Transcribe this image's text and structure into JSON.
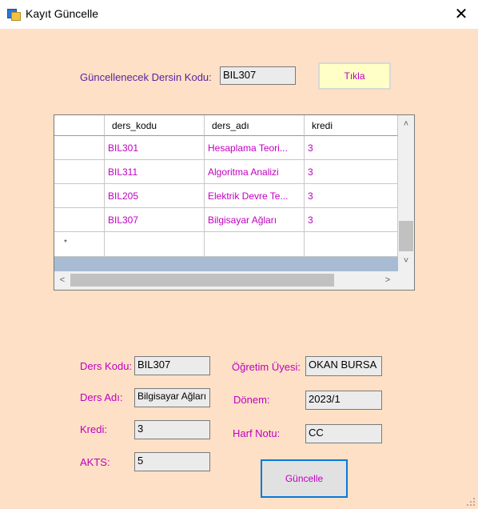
{
  "window": {
    "title": "Kayıt Güncelle",
    "close_glyph": "✕"
  },
  "lookup": {
    "label": "Güncellenecek Dersin Kodu:",
    "value": "BIL307",
    "button_label": "Tıkla"
  },
  "grid": {
    "columns": [
      "ders_kodu",
      "ders_adı",
      "kredi"
    ],
    "rows": [
      [
        "BIL301",
        "Hesaplama Teori...",
        "3"
      ],
      [
        "BIL311",
        "Algoritma Analizi",
        "3"
      ],
      [
        "BIL205",
        "Elektrik Devre Te...",
        "3"
      ],
      [
        "BIL307",
        "Bilgisayar Ağları",
        "3"
      ]
    ],
    "new_row_marker": "*",
    "scroll_up": "˄",
    "scroll_down": "˅",
    "scroll_left": "<",
    "scroll_right": ">"
  },
  "form": {
    "ders_kodu": {
      "label": "Ders Kodu:",
      "value": "BIL307"
    },
    "ders_adi": {
      "label": "Ders Adı:",
      "value": "Bilgisayar Ağları"
    },
    "kredi": {
      "label": "Kredi:",
      "value": "3"
    },
    "akts": {
      "label": "AKTS:",
      "value": "5"
    },
    "ogretim_uyesi": {
      "label": "Öğretim Üyesi:",
      "value": "OKAN BURSA"
    },
    "donem": {
      "label": "Dönem:",
      "value": "2023/1"
    },
    "harf_notu": {
      "label": "Harf Notu:",
      "value": "CC"
    },
    "update_button": "Güncelle"
  },
  "colors": {
    "background": "#fde0c5",
    "accent": "#c000c0",
    "label": "#5b1fa0",
    "focus_border": "#0a78d7"
  },
  "icons": {
    "app": "form-window-icon",
    "close": "close-icon"
  }
}
